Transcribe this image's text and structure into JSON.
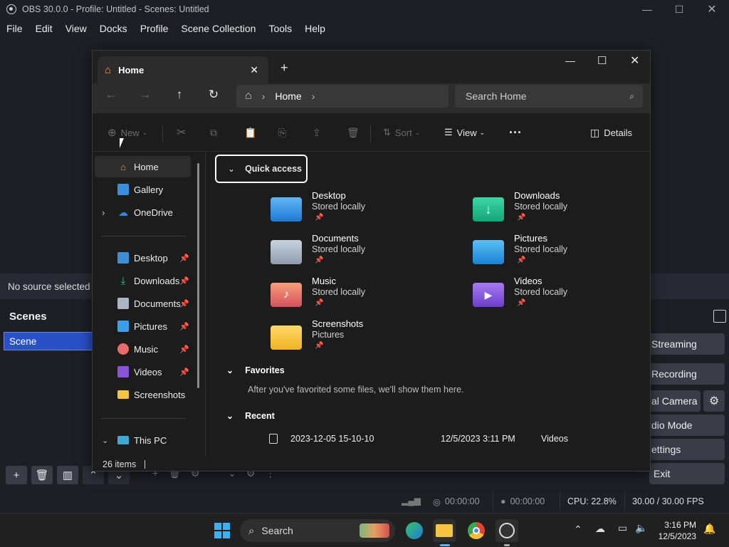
{
  "obs": {
    "title": "OBS 30.0.0 - Profile: Untitled - Scenes: Untitled",
    "menu": [
      "File",
      "Edit",
      "View",
      "Docks",
      "Profile",
      "Scene Collection",
      "Tools",
      "Help"
    ],
    "no_source": "No source selected",
    "scenes_header": "Scenes",
    "scene_item": "Scene",
    "controls": [
      "Streaming",
      "Recording",
      "al Camera",
      "dio Mode",
      "ettings",
      "Exit"
    ],
    "status": {
      "net": "00:00:00",
      "rec": "00:00:00",
      "cpu": "CPU: 22.8%",
      "fps": "30.00 / 30.00 FPS"
    }
  },
  "explorer": {
    "tab_title": "Home",
    "address": "Home",
    "search_placeholder": "Search Home",
    "cmd": {
      "new": "New",
      "sort": "Sort",
      "view": "View",
      "details": "Details"
    },
    "nav": [
      {
        "label": "Home"
      },
      {
        "label": "Gallery"
      },
      {
        "label": "OneDrive"
      },
      {
        "label": "Desktop"
      },
      {
        "label": "Downloads"
      },
      {
        "label": "Documents"
      },
      {
        "label": "Pictures"
      },
      {
        "label": "Music"
      },
      {
        "label": "Videos"
      },
      {
        "label": "Screenshots"
      },
      {
        "label": "This PC"
      }
    ],
    "quick_access": "Quick access",
    "tiles": [
      {
        "name": "Desktop",
        "sub": "Stored locally"
      },
      {
        "name": "Downloads",
        "sub": "Stored locally"
      },
      {
        "name": "Documents",
        "sub": "Stored locally"
      },
      {
        "name": "Pictures",
        "sub": "Stored locally"
      },
      {
        "name": "Music",
        "sub": "Stored locally"
      },
      {
        "name": "Videos",
        "sub": "Stored locally"
      },
      {
        "name": "Screenshots",
        "sub": "Pictures"
      }
    ],
    "favorites": "Favorites",
    "favorites_empty": "After you've favorited some files, we'll show them here.",
    "recent": "Recent",
    "recent_item": {
      "name": "2023-12-05 15-10-10",
      "date": "12/5/2023 3:11 PM",
      "location": "Videos"
    },
    "item_count": "26 items"
  },
  "taskbar": {
    "search": "Search",
    "time": "3:16 PM",
    "date": "12/5/2023"
  },
  "colors": {
    "accent": "#2a50c8",
    "obs_bg": "#1e1f25",
    "explorer_bg": "#1c1c1c"
  }
}
